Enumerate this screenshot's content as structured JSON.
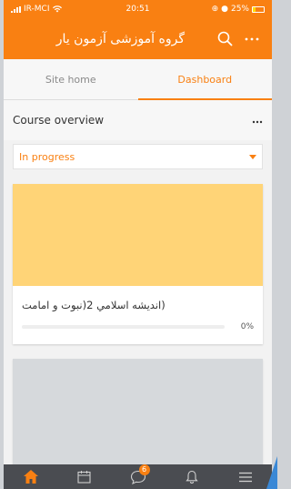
{
  "status_bar": {
    "carrier": "IR-MCI",
    "time": "20:51",
    "battery": "25%"
  },
  "app_bar": {
    "title": "گروه آموزشی آزمون یار",
    "search_icon": "search-icon",
    "more_icon": "more-icon"
  },
  "tabs": [
    {
      "label": "Site home",
      "active": false
    },
    {
      "label": "Dashboard",
      "active": true
    }
  ],
  "course_overview": {
    "title": "Course overview",
    "more": "⋮",
    "filter_value": "In progress"
  },
  "courses": [
    {
      "name": "(اندیشه اسلامي 2(نبوت و امامت",
      "progress_label": "0%",
      "progress": 0,
      "image_color": "#ffd477"
    }
  ],
  "bottom_nav": {
    "items": [
      "home-icon",
      "calendar-icon",
      "messages-icon",
      "notifications-icon",
      "menu-icon"
    ],
    "messages_badge": "6"
  },
  "colors": {
    "accent": "#f98012",
    "nav_bg": "#4a4c51",
    "page_bg": "#f2f2f2"
  }
}
